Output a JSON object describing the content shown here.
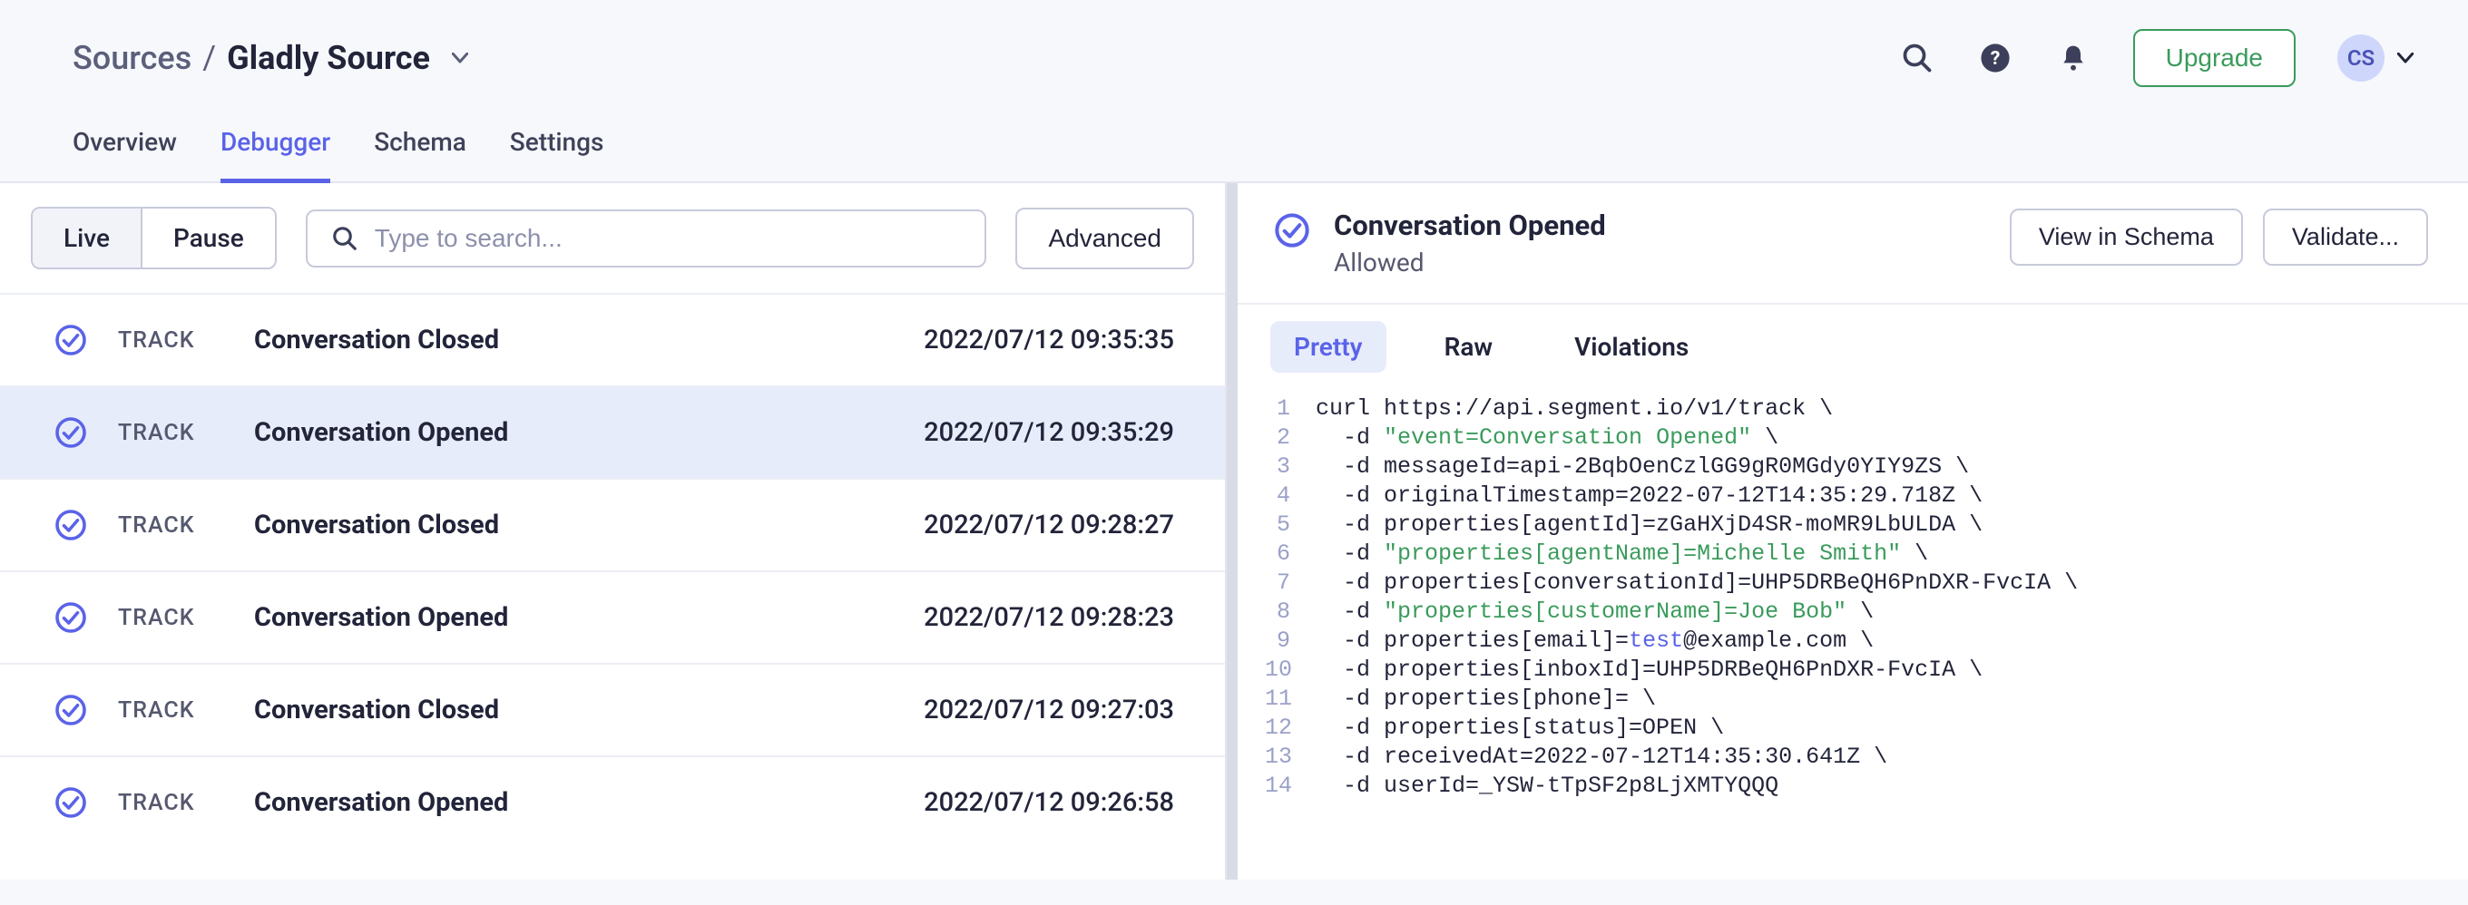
{
  "breadcrumb": {
    "root": "Sources",
    "current": "Gladly Source"
  },
  "header": {
    "upgrade": "Upgrade",
    "avatar_initials": "CS"
  },
  "tabs": [
    {
      "id": "overview",
      "label": "Overview",
      "active": false
    },
    {
      "id": "debugger",
      "label": "Debugger",
      "active": true
    },
    {
      "id": "schema",
      "label": "Schema",
      "active": false
    },
    {
      "id": "settings",
      "label": "Settings",
      "active": false
    }
  ],
  "toolbar": {
    "live": "Live",
    "pause": "Pause",
    "search_placeholder": "Type to search...",
    "advanced": "Advanced"
  },
  "events": [
    {
      "type": "TRACK",
      "name": "Conversation Closed",
      "time": "2022/07/12 09:35:35",
      "selected": false
    },
    {
      "type": "TRACK",
      "name": "Conversation Opened",
      "time": "2022/07/12 09:35:29",
      "selected": true
    },
    {
      "type": "TRACK",
      "name": "Conversation Closed",
      "time": "2022/07/12 09:28:27",
      "selected": false
    },
    {
      "type": "TRACK",
      "name": "Conversation Opened",
      "time": "2022/07/12 09:28:23",
      "selected": false
    },
    {
      "type": "TRACK",
      "name": "Conversation Closed",
      "time": "2022/07/12 09:27:03",
      "selected": false
    },
    {
      "type": "TRACK",
      "name": "Conversation Opened",
      "time": "2022/07/12 09:26:58",
      "selected": false
    }
  ],
  "detail": {
    "title": "Conversation Opened",
    "status": "Allowed",
    "view_schema": "View in Schema",
    "validate": "Validate..."
  },
  "subtabs": [
    {
      "id": "pretty",
      "label": "Pretty",
      "active": true
    },
    {
      "id": "raw",
      "label": "Raw",
      "active": false
    },
    {
      "id": "violations",
      "label": "Violations",
      "active": false
    }
  ],
  "code": [
    {
      "n": 1,
      "segs": [
        {
          "t": "curl https://api.segment.io/v1/track \\"
        }
      ]
    },
    {
      "n": 2,
      "segs": [
        {
          "t": "  -d "
        },
        {
          "t": "\"event=Conversation Opened\"",
          "c": "tok-str"
        },
        {
          "t": " \\"
        }
      ]
    },
    {
      "n": 3,
      "segs": [
        {
          "t": "  -d messageId=api-2BqbOenCzlGG9gR0MGdy0YIY9ZS \\"
        }
      ]
    },
    {
      "n": 4,
      "segs": [
        {
          "t": "  -d originalTimestamp=2022-07-12T14:35:29.718Z \\"
        }
      ]
    },
    {
      "n": 5,
      "segs": [
        {
          "t": "  -d properties[agentId]=zGaHXjD4SR-moMR9LbULDA \\"
        }
      ]
    },
    {
      "n": 6,
      "segs": [
        {
          "t": "  -d "
        },
        {
          "t": "\"properties[agentName]=Michelle Smith\"",
          "c": "tok-str"
        },
        {
          "t": " \\"
        }
      ]
    },
    {
      "n": 7,
      "segs": [
        {
          "t": "  -d properties[conversationId]=UHP5DRBeQH6PnDXR-FvcIA \\"
        }
      ]
    },
    {
      "n": 8,
      "segs": [
        {
          "t": "  -d "
        },
        {
          "t": "\"properties[customerName]=Joe Bob\"",
          "c": "tok-str"
        },
        {
          "t": " \\"
        }
      ]
    },
    {
      "n": 9,
      "segs": [
        {
          "t": "  -d properties[email]="
        },
        {
          "t": "test",
          "c": "tok-kw"
        },
        {
          "t": "@example.com \\"
        }
      ]
    },
    {
      "n": 10,
      "segs": [
        {
          "t": "  -d properties[inboxId]=UHP5DRBeQH6PnDXR-FvcIA \\"
        }
      ]
    },
    {
      "n": 11,
      "segs": [
        {
          "t": "  -d properties[phone]= \\"
        }
      ]
    },
    {
      "n": 12,
      "segs": [
        {
          "t": "  -d properties[status]=OPEN \\"
        }
      ]
    },
    {
      "n": 13,
      "segs": [
        {
          "t": "  -d receivedAt=2022-07-12T14:35:30.641Z \\"
        }
      ]
    },
    {
      "n": 14,
      "segs": [
        {
          "t": "  -d userId=_YSW-tTpSF2p8LjXMTYQQQ"
        }
      ]
    }
  ]
}
